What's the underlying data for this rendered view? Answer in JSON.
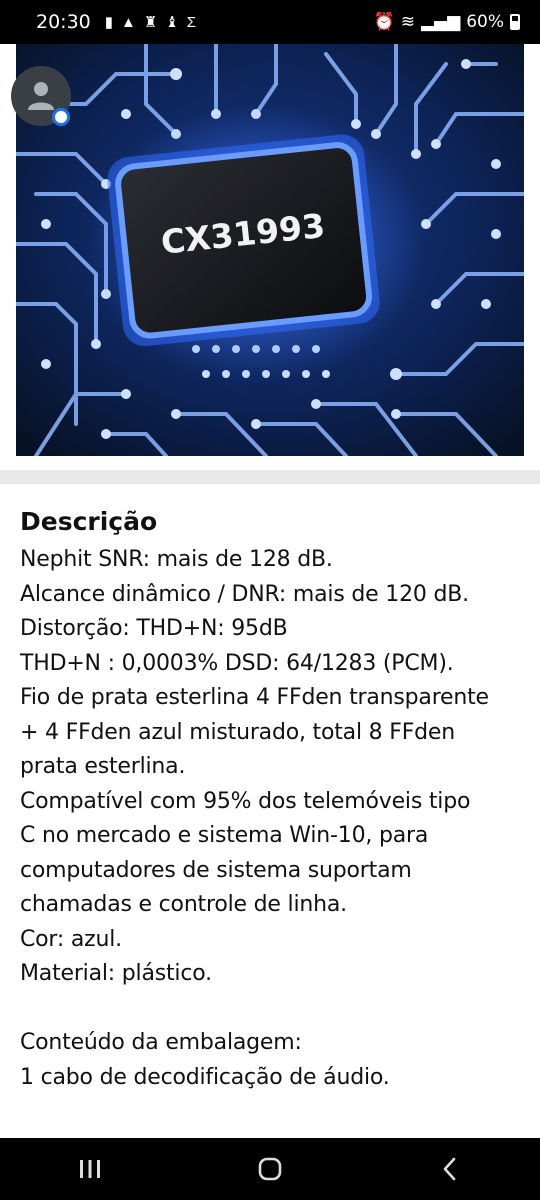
{
  "status_bar": {
    "time": "20:30",
    "battery": "60%",
    "notification_icons": [
      "storage-icon",
      "warning-icon",
      "rocket-icon",
      "rocket-icon",
      "sigma-icon"
    ]
  },
  "product_image": {
    "chip_label": "CX31993"
  },
  "description": {
    "title": "Descrição",
    "lines": [
      "Nephit SNR: mais de 128 dB.",
      "Alcance dinâmico / DNR: mais de 120 dB.",
      "Distorção: THD+N: 95dB",
      "THD+N : 0,0003% DSD: 64/1283 (PCM).",
      "Fio de prata esterlina 4 FFden transparente",
      "+ 4 FFden azul misturado, total 8 FFden",
      "prata esterlina.",
      "Compatível com 95% dos telemóveis tipo",
      "C no mercado e sistema Win-10, para",
      "computadores de sistema suportam",
      "chamadas e controle de linha.",
      "Cor: azul.",
      "Material: plástico.",
      "",
      "Conteúdo da embalagem:",
      "1 cabo de decodificação de áudio."
    ]
  },
  "colors": {
    "accent": "#1a73e8",
    "chip_glow": "#2f6bff",
    "circuit": "#8fb6ff"
  }
}
